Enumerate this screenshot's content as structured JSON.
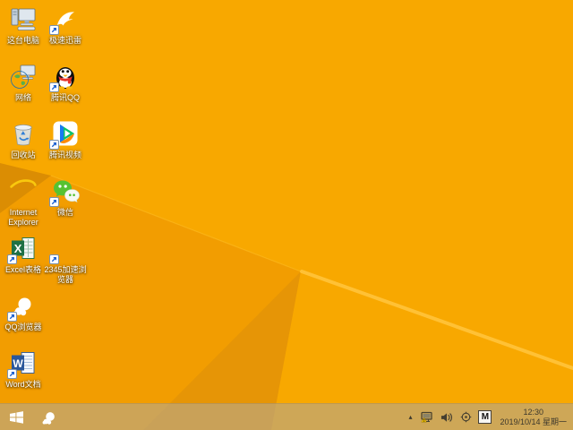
{
  "desktop": {
    "icons": [
      {
        "label": "这台电脑",
        "icon": "this-pc",
        "col": 0,
        "row": 0,
        "shortcut": false
      },
      {
        "label": "极速迅雷",
        "icon": "thunder",
        "col": 1,
        "row": 0,
        "shortcut": true
      },
      {
        "label": "网络",
        "icon": "network",
        "col": 0,
        "row": 1,
        "shortcut": false
      },
      {
        "label": "腾讯QQ",
        "icon": "qq",
        "col": 1,
        "row": 1,
        "shortcut": true
      },
      {
        "label": "回收站",
        "icon": "recycle-bin",
        "col": 0,
        "row": 2,
        "shortcut": false
      },
      {
        "label": "腾讯视频",
        "icon": "tencent-video",
        "col": 1,
        "row": 2,
        "shortcut": true
      },
      {
        "label": "Internet Explorer",
        "icon": "internet-explorer",
        "col": 0,
        "row": 3,
        "shortcut": false
      },
      {
        "label": "微信",
        "icon": "wechat",
        "col": 1,
        "row": 3,
        "shortcut": true
      },
      {
        "label": "Excel表格",
        "icon": "excel",
        "col": 0,
        "row": 4,
        "shortcut": true
      },
      {
        "label": "2345加速浏览器",
        "icon": "browser-2345",
        "col": 1,
        "row": 4,
        "shortcut": true
      },
      {
        "label": "QQ浏览器",
        "icon": "qq-browser",
        "col": 0,
        "row": 5,
        "shortcut": true
      },
      {
        "label": "Word文档",
        "icon": "word",
        "col": 0,
        "row": 6,
        "shortcut": true
      }
    ]
  },
  "taskbar": {
    "start_button": {
      "icon": "windows-logo-icon"
    },
    "pinned": [
      {
        "icon": "qq-browser"
      }
    ],
    "tray": {
      "hidden_icons_glyph": "▴",
      "icons": [
        "hidden-icons-chevron",
        "network-warning-icon",
        "volume-icon",
        "safety-scan-icon",
        "ime-indicator"
      ],
      "ime_mode": "M"
    },
    "clock": {
      "time": "12:30",
      "date": "2019/10/14 星期一"
    }
  },
  "colors": {
    "wallpaper_base": "#F8A800",
    "wallpaper_shade": "#F29D01",
    "wallpaper_dark_wedge": "#DB8D03",
    "wallpaper_fan": "#E69506",
    "wallpaper_olive": "#A89A62",
    "wallpaper_cream": "#F3ECDC",
    "wallpaper_ridge": "#FFC135",
    "taskbar_tint": "rgba(190,166,120,0.72)",
    "tray_text": "#3D382C",
    "icon_label_text": "#FFFFFF"
  }
}
